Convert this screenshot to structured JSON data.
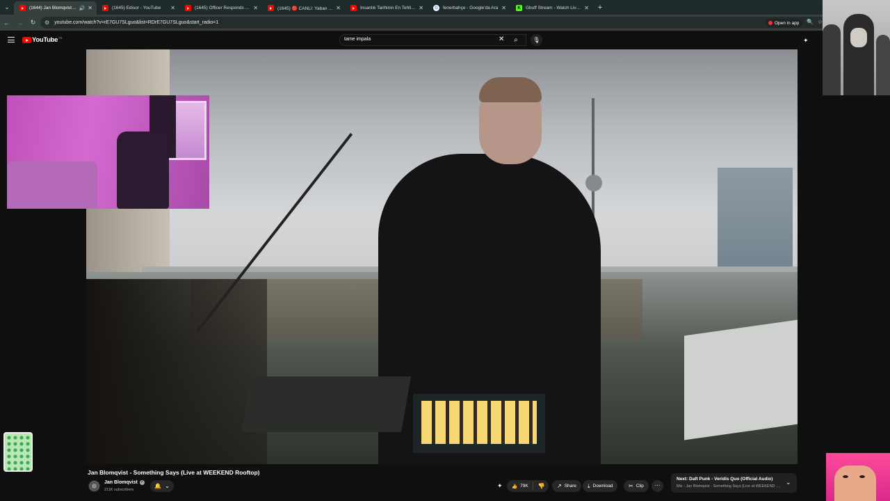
{
  "browser": {
    "tabs": [
      {
        "title": "(1644) Jan Blomqvist - Som",
        "icon": "youtube",
        "active": true,
        "audio": true
      },
      {
        "title": "(1645) Edisor - YouTube",
        "icon": "youtube",
        "active": false
      },
      {
        "title": "(1645) Officer Responds to 'Ma",
        "icon": "youtube",
        "active": false
      },
      {
        "title": "(1645) 🔴 CANLI: Yaban Hayatı",
        "icon": "youtube",
        "active": false
      },
      {
        "title": "İnsanlık Tarihinin En Tehlikeli Ar",
        "icon": "youtube",
        "active": false
      },
      {
        "title": "fenerbahçe - Google'da Ara",
        "icon": "google",
        "active": false
      },
      {
        "title": "Gbuff Stream - Watch Live on K",
        "icon": "kick",
        "active": false
      }
    ],
    "new_tab": "+",
    "url": "youtube.com/watch?v=rE7GU7SLguo&list=RDrE7GU7SLguo&start_radio=1",
    "open_in_app": "Open in app"
  },
  "youtube": {
    "logo": "YouTube",
    "logo_country": "TR",
    "search_query": "tame impala",
    "video_title": "Jan Blomqvist - Something Says (Live at WEEKEND Rooftop)",
    "channel_name": "Jan Blomqvist",
    "subscribers": "211K subscribers",
    "likes": "79K",
    "share_label": "Share",
    "download_label": "Download",
    "clip_label": "Clip",
    "next": {
      "title": "Next: Daft Punk - Veridis Quo (Official Audio)",
      "subtitle": "Mix - Jan Blomqvist - Something Says (Live at WEEKEND Ro..."
    }
  },
  "colors": {
    "brand": "#ff0000",
    "background": "#0f0f0f",
    "chip": "#272727",
    "browser_frame": "#35403f"
  }
}
